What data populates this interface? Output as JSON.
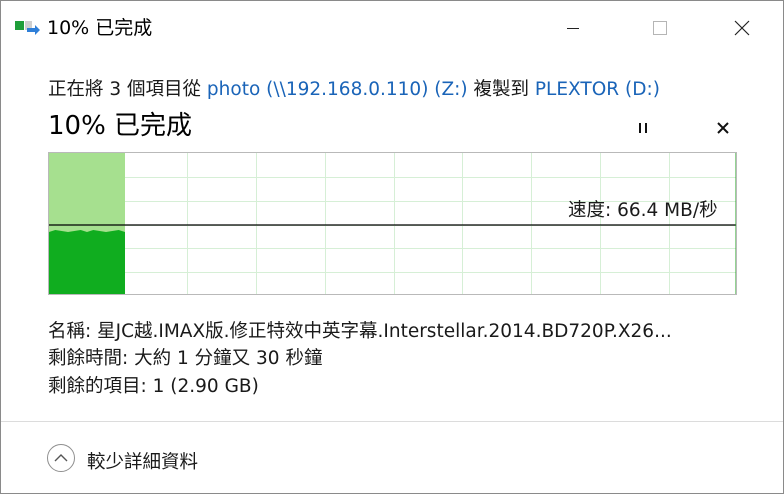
{
  "window": {
    "title": "10% 已完成",
    "icons": {
      "app": "copy-transfer-icon",
      "minimize": "minimize-icon",
      "maximize": "maximize-icon",
      "close": "close-icon"
    }
  },
  "status": {
    "prefix": "正在將 3 個項目從 ",
    "source": "photo (\\\\192.168.0.110) (Z:)",
    "middle": " 複製到 ",
    "destination": "PLEXTOR (D:)"
  },
  "progress": {
    "headline": "10% 已完成",
    "percent": 10
  },
  "controls": {
    "pause_icon": "pause-icon",
    "cancel_icon": "cancel-icon"
  },
  "graph": {
    "speed_text": "速度: 66.4 MB/秒",
    "colors": {
      "fill_done": "#a6e08f",
      "speed_fill": "#10ad1f",
      "grid": "#d6efd6",
      "border_right": "#27a827",
      "speed_line": "#000000"
    }
  },
  "details": {
    "name_label": "名稱:",
    "name_value": "星JC越.IMAX版.修正特效中英字幕.Interstellar.2014.BD720P.X26...",
    "time_label": "剩餘時間:",
    "time_value": "大約 1 分鐘又 30 秒鐘",
    "items_label": "剩餘的項目:",
    "items_value": "1 (2.90 GB)"
  },
  "footer": {
    "toggle_icon": "chevron-up-icon",
    "toggle_label": "較少詳細資料"
  }
}
